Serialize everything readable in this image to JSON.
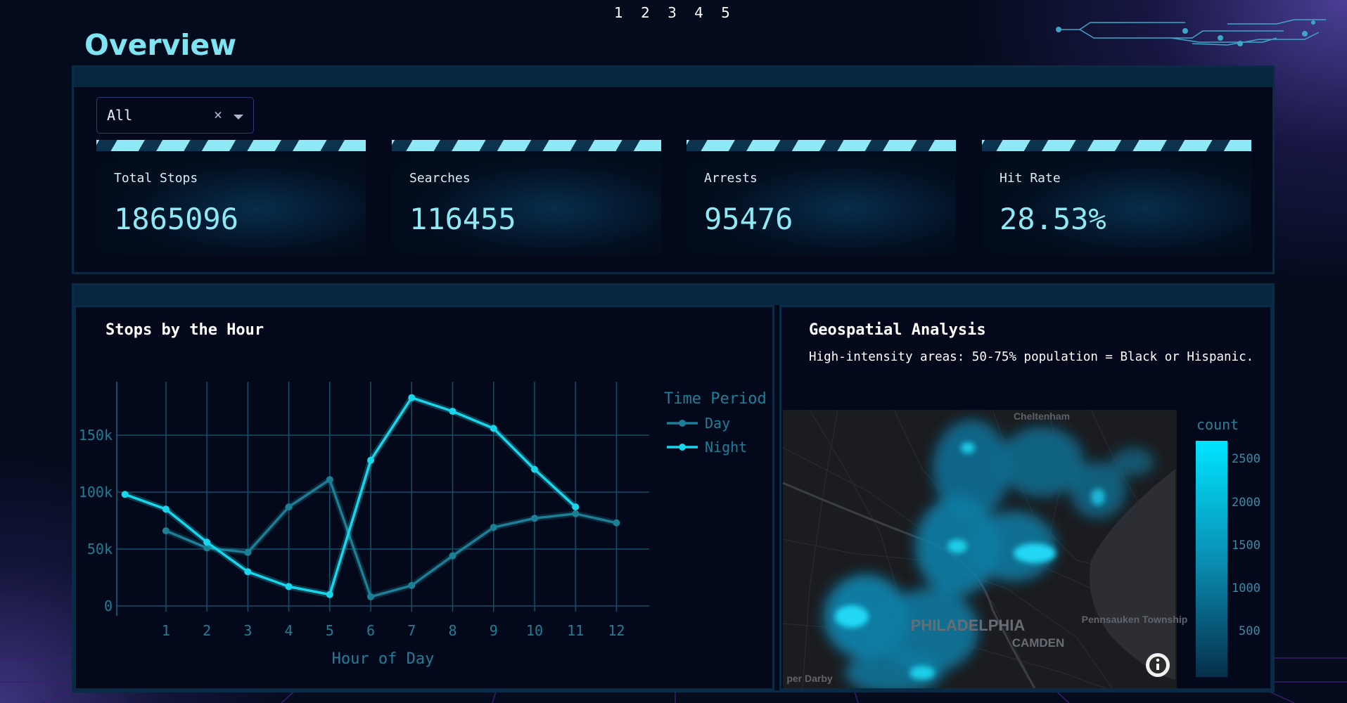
{
  "pagination": [
    "1",
    "2",
    "3",
    "4",
    "5"
  ],
  "page_title": "Overview",
  "filter": {
    "value": "All",
    "clear_symbol": "×"
  },
  "kpis": [
    {
      "label": "Total Stops",
      "value": "1865096"
    },
    {
      "label": "Searches",
      "value": "116455"
    },
    {
      "label": "Arrests",
      "value": "95476"
    },
    {
      "label": "Hit Rate",
      "value": "28.53%"
    }
  ],
  "line_card": {
    "title": "Stops by the Hour"
  },
  "map_card": {
    "title": "Geospatial Analysis",
    "subtitle": "High-intensity areas: 50-75% population = Black or Hispanic.",
    "map_labels": [
      "Cheltenham",
      "PHILADELPHIA",
      "CAMDEN",
      "Pennsauken Township",
      "per Darby"
    ],
    "colorbar": {
      "title": "count",
      "ticks": [
        "2500",
        "2000",
        "1500",
        "1000",
        "500"
      ]
    },
    "info_icon": "info-icon"
  },
  "colors": {
    "accent": "#7fe4f2",
    "day": "#1d7f96",
    "night": "#18d6ec",
    "panel_border": "#0a2b45"
  },
  "chart_data": {
    "type": "line",
    "title": "Stops by the Hour",
    "xlabel": "Hour of Day",
    "ylabel": "",
    "legend_title": "Time Period",
    "legend_position": "top-right",
    "x_ticks": [
      1,
      2,
      3,
      4,
      5,
      6,
      7,
      8,
      9,
      10,
      11,
      12
    ],
    "y_ticks": [
      0,
      50000,
      100000,
      150000
    ],
    "y_tick_labels": [
      "0",
      "50k",
      "100k",
      "150k"
    ],
    "xlim": [
      -0.2,
      12.8
    ],
    "ylim": [
      -5000,
      197000
    ],
    "grid": true,
    "series": [
      {
        "name": "Day",
        "x": [
          1,
          2,
          3,
          4,
          5,
          6,
          7,
          8,
          9,
          10,
          11,
          12
        ],
        "y": [
          66000,
          51000,
          47000,
          87000,
          111000,
          8000,
          18000,
          44000,
          69000,
          77000,
          81000,
          73000
        ]
      },
      {
        "name": "Night",
        "x": [
          0,
          1,
          2,
          3,
          4,
          5,
          6,
          7,
          8,
          9,
          10,
          11
        ],
        "y": [
          98000,
          85000,
          56000,
          30000,
          17000,
          10000,
          128000,
          183000,
          171000,
          156000,
          120000,
          87000
        ]
      }
    ]
  }
}
